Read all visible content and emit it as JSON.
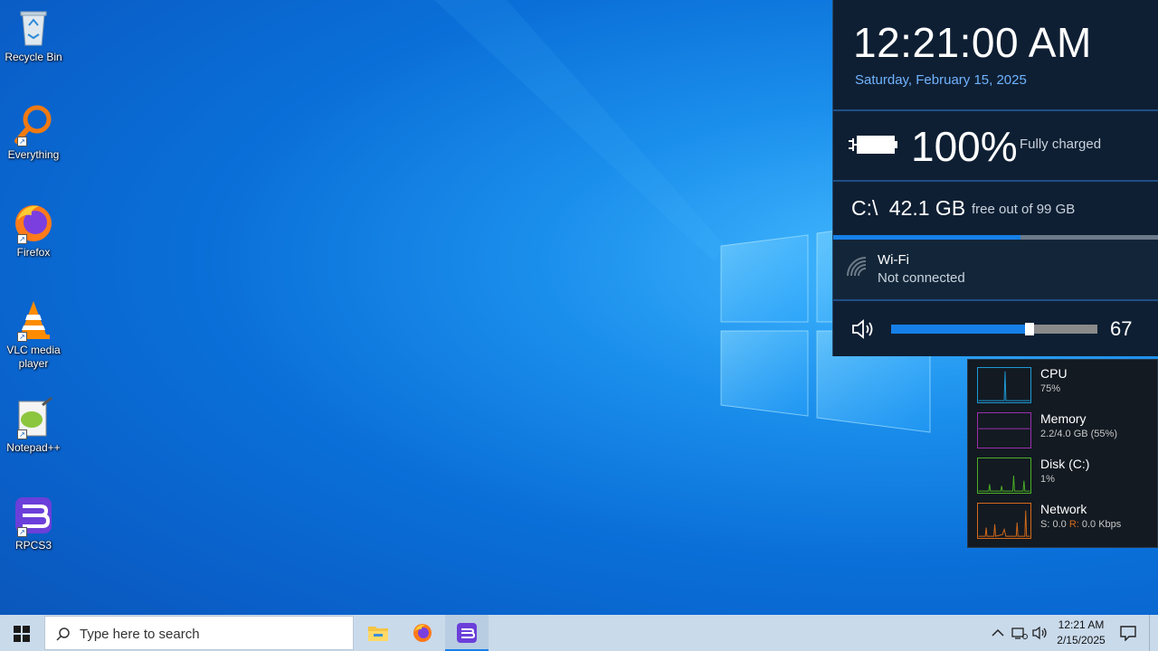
{
  "desktop": {
    "icons": [
      {
        "label": "Recycle Bin",
        "icon": "recycle-bin-icon"
      },
      {
        "label": "Everything",
        "icon": "search-magnifier-icon"
      },
      {
        "label": "Firefox",
        "icon": "firefox-icon"
      },
      {
        "label": "VLC media player",
        "icon": "vlc-cone-icon"
      },
      {
        "label": "Notepad++",
        "icon": "notepadpp-icon"
      },
      {
        "label": "RPCS3",
        "icon": "rpcs3-icon"
      }
    ]
  },
  "flyout": {
    "time": "12:21:00 AM",
    "date": "Saturday, February 15, 2025",
    "battery": {
      "percent_text": "100%",
      "status": "Fully charged",
      "level": 1.0
    },
    "disk": {
      "drive": "C:\\",
      "free": "42.1 GB",
      "detail": "free out of 99 GB",
      "used_fraction": 0.575
    },
    "wifi": {
      "name": "Wi-Fi",
      "status": "Not connected"
    },
    "volume": {
      "value_text": "67",
      "level": 0.67
    }
  },
  "perf": {
    "rows": [
      {
        "title": "CPU",
        "sub": "75%",
        "color": "#1e9bd7"
      },
      {
        "title": "Memory",
        "sub": "2.2/4.0 GB (55%)",
        "color": "#9b2fae"
      },
      {
        "title": "Disk (C:)",
        "sub": "1%",
        "color": "#4caf25"
      },
      {
        "title": "Network",
        "sub_s": "S: 0.0",
        "sub_r": "R:",
        "sub_r_val": "0.0 Kbps",
        "color": "#d46a1a"
      }
    ]
  },
  "taskbar": {
    "search_placeholder": "Type here to search",
    "clock_time": "12:21 AM",
    "clock_date": "2/15/2025"
  },
  "colors": {
    "accent": "#1680e8",
    "flyout_bg": "#0f1f33",
    "taskbar_bg": "#c9daeb"
  }
}
